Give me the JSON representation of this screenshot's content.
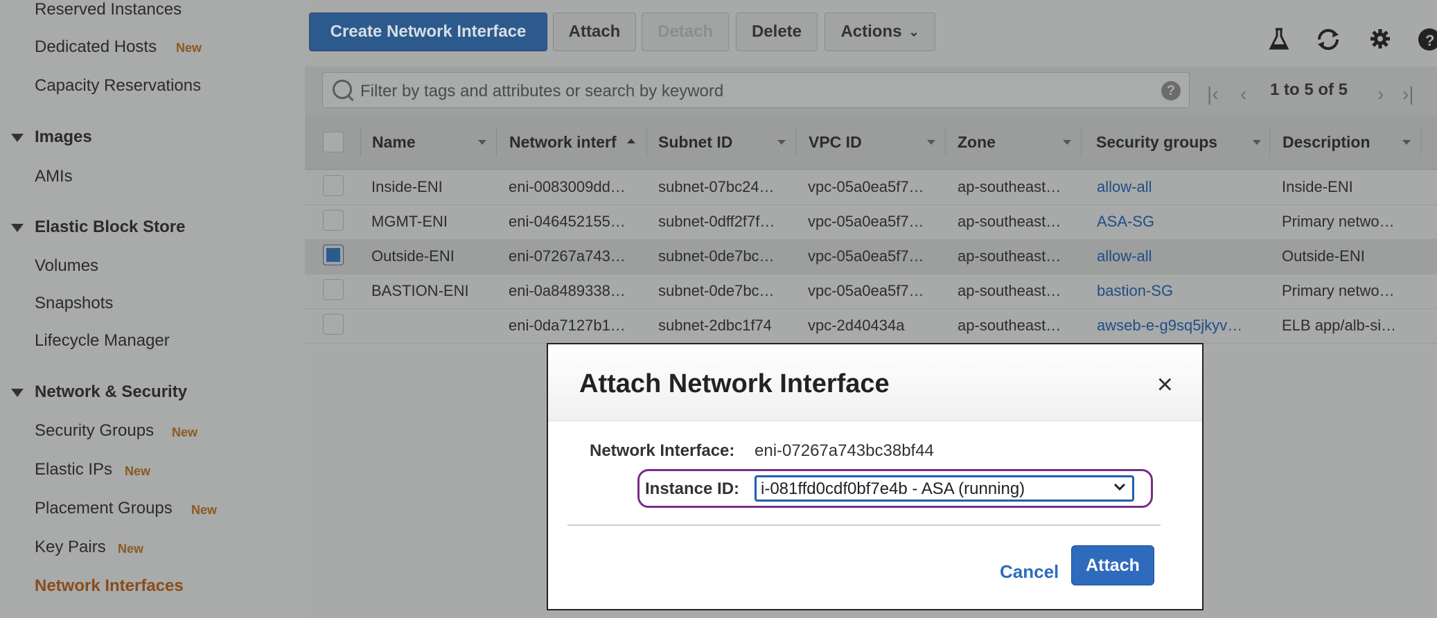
{
  "sidebar": {
    "items": [
      {
        "label": "Reserved Instances",
        "new": ""
      },
      {
        "label": "Dedicated Hosts",
        "new": "New"
      },
      {
        "label": "Capacity Reservations",
        "new": ""
      }
    ],
    "sections": [
      {
        "title": "Images",
        "items": [
          {
            "label": "AMIs",
            "new": ""
          }
        ]
      },
      {
        "title": "Elastic Block Store",
        "items": [
          {
            "label": "Volumes",
            "new": ""
          },
          {
            "label": "Snapshots",
            "new": ""
          },
          {
            "label": "Lifecycle Manager",
            "new": ""
          }
        ]
      },
      {
        "title": "Network & Security",
        "items": [
          {
            "label": "Security Groups",
            "new": "New"
          },
          {
            "label": "Elastic IPs",
            "new": "New"
          },
          {
            "label": "Placement Groups",
            "new": "New"
          },
          {
            "label": "Key Pairs",
            "new": "New"
          },
          {
            "label": "Network Interfaces",
            "new": ""
          }
        ]
      }
    ]
  },
  "toolbar": {
    "create_label": "Create Network Interface",
    "attach_label": "Attach",
    "detach_label": "Detach",
    "delete_label": "Delete",
    "actions_label": "Actions"
  },
  "filter": {
    "placeholder": "Filter by tags and attributes or search by keyword",
    "help": "?"
  },
  "pagination": {
    "text": "1 to 5 of 5"
  },
  "table": {
    "columns": [
      "Name",
      "Network interf",
      "Subnet ID",
      "VPC ID",
      "Zone",
      "Security groups",
      "Description"
    ],
    "rows": [
      {
        "name": "Inside-ENI",
        "eni": "eni-0083009dd…",
        "subnet": "subnet-07bc24…",
        "vpc": "vpc-05a0ea5f7…",
        "zone": "ap-southeast…",
        "sg": "allow-all",
        "desc": "Inside-ENI",
        "checked": false
      },
      {
        "name": "MGMT-ENI",
        "eni": "eni-046452155…",
        "subnet": "subnet-0dff2f7f…",
        "vpc": "vpc-05a0ea5f7…",
        "zone": "ap-southeast…",
        "sg": "ASA-SG",
        "desc": "Primary netwo…",
        "checked": false
      },
      {
        "name": "Outside-ENI",
        "eni": "eni-07267a743…",
        "subnet": "subnet-0de7bc…",
        "vpc": "vpc-05a0ea5f7…",
        "zone": "ap-southeast…",
        "sg": "allow-all",
        "desc": "Outside-ENI",
        "checked": true
      },
      {
        "name": "BASTION-ENI",
        "eni": "eni-0a8489338…",
        "subnet": "subnet-0de7bc…",
        "vpc": "vpc-05a0ea5f7…",
        "zone": "ap-southeast…",
        "sg": "bastion-SG",
        "desc": "Primary netwo…",
        "checked": false
      },
      {
        "name": "",
        "eni": "eni-0da7127b1…",
        "subnet": "subnet-2dbc1f74",
        "vpc": "vpc-2d40434a",
        "zone": "ap-southeast…",
        "sg": "awseb-e-g9sq5jkyv…",
        "desc": "ELB app/alb-si…",
        "checked": false
      }
    ]
  },
  "modal": {
    "title": "Attach Network Interface",
    "close": "×",
    "ni_label": "Network Interface:",
    "ni_value": "eni-07267a743bc38bf44",
    "instance_label": "Instance ID:",
    "instance_value": "i-081ffd0cdf0bf7e4b - ASA (running)",
    "cancel_label": "Cancel",
    "attach_label": "Attach"
  }
}
